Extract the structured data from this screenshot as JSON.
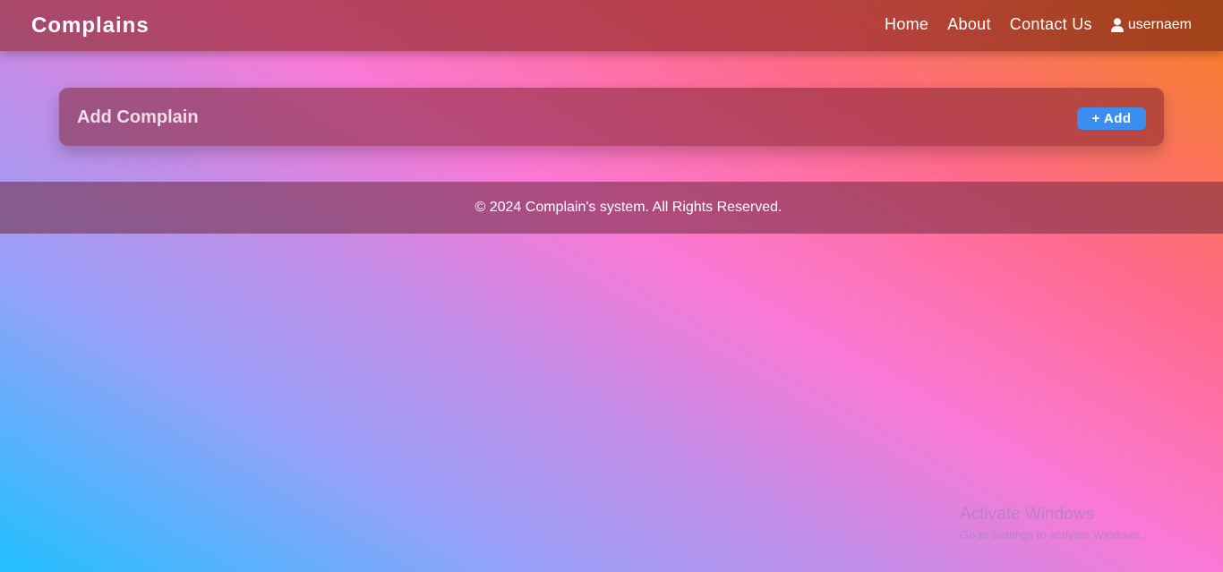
{
  "navbar": {
    "brand": "Complains",
    "links": [
      {
        "label": "Home"
      },
      {
        "label": "About"
      },
      {
        "label": "Contact Us"
      }
    ],
    "user": {
      "name": "usernaem",
      "icon": "user-icon"
    }
  },
  "panel": {
    "title": "Add Complain",
    "add_button_label": "+ Add",
    "button_color": "#3b8ef0"
  },
  "footer": {
    "text": "© 2024 Complain's system. All Rights Reserved."
  },
  "watermark": {
    "title": "Activate Windows",
    "subtitle": "Go to Settings to activate Windows."
  }
}
